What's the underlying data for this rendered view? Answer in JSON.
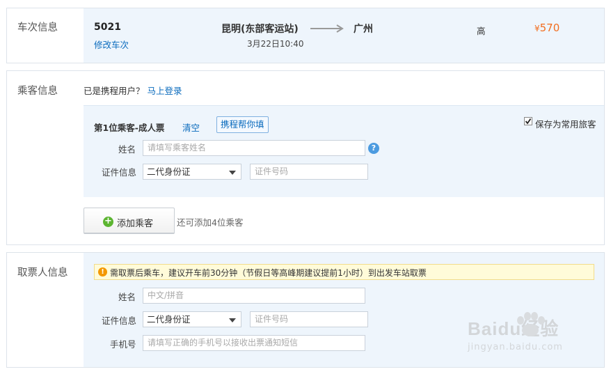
{
  "train": {
    "section_label": "车次信息",
    "number": "5021",
    "modify_link": "修改车次",
    "from_station": "昆明(东部客运站)",
    "depart_time": "3月22日10:40",
    "to_station": "广州",
    "seat_class": "高",
    "currency": "¥",
    "price": "570"
  },
  "passenger": {
    "section_label": "乘客信息",
    "member_prompt": "已是携程用户？",
    "login_link": "马上登录",
    "card_title": "第1位乘客-成人票",
    "clear_link": "清空",
    "autofill_button": "携程帮你填",
    "save_checkbox_label": "保存为常用旅客",
    "save_checked": true,
    "name_label": "姓名",
    "name_placeholder": "请填写乘客姓名",
    "help_icon": "?",
    "id_label": "证件信息",
    "id_type": "二代身份证",
    "id_placeholder": "证件号码",
    "add_button": "添加乘客",
    "remaining_text": "还可添加4位乘客"
  },
  "pickup": {
    "section_label": "取票人信息",
    "notice": "需取票后乘车，建议开车前30分钟（节假日等高峰期建议提前1小时）到出发车站取票",
    "name_label": "姓名",
    "name_placeholder": "中文/拼音",
    "id_label": "证件信息",
    "id_type": "二代身份证",
    "id_placeholder": "证件号码",
    "phone_label": "手机号",
    "phone_placeholder": "请填写正确的手机号以接收出票通知短信"
  },
  "watermark": {
    "brand": "Baidu经验",
    "url": "jingyan.baidu.com"
  },
  "colors": {
    "link": "#0a6bbd",
    "price": "#f26e1f",
    "panel": "#eef5fc",
    "notice_bg": "#fffbd9",
    "notice_icon": "#f39800",
    "add_icon": "#5cb531",
    "help_icon": "#4c9be0"
  }
}
